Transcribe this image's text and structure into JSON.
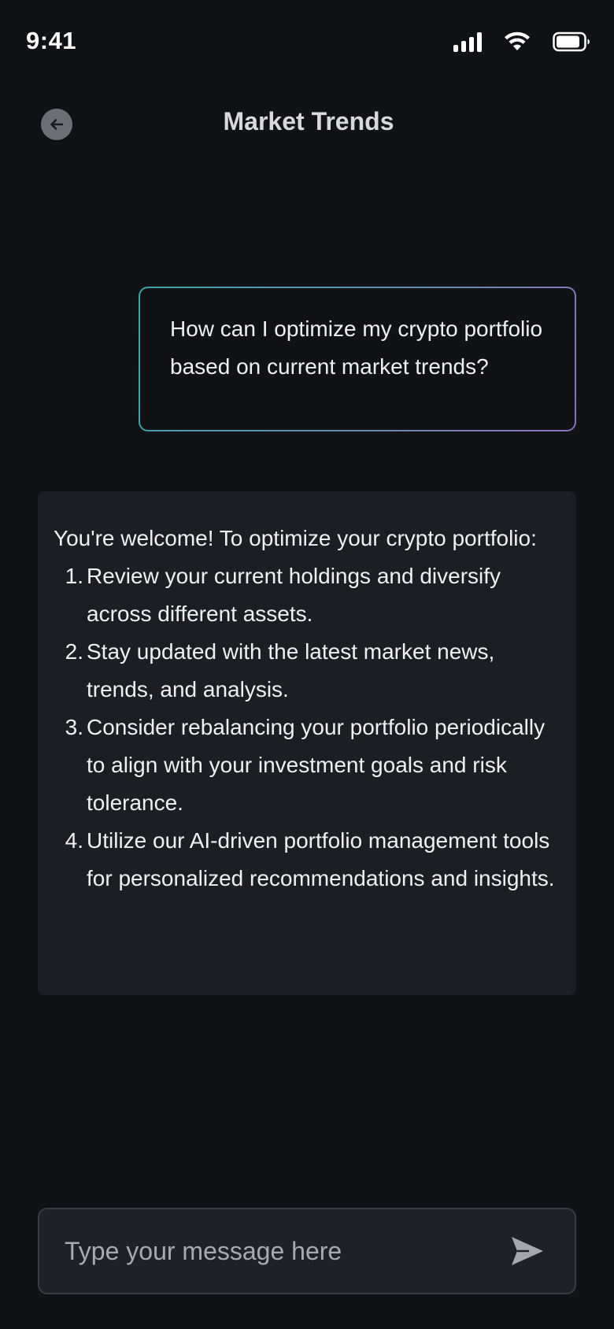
{
  "status_bar": {
    "time": "9:41",
    "icons": [
      "cellular-signal-icon",
      "wifi-icon",
      "battery-icon"
    ]
  },
  "header": {
    "back_icon": "arrow-left-icon",
    "title": "Market Trends"
  },
  "conversation": {
    "user_message": "How can I optimize my crypto portfolio based on current market trends?",
    "ai_response": {
      "intro": " You're welcome! To optimize your crypto portfolio:",
      "items": [
        {
          "num": "1.",
          "text": "Review your current holdings and diversify across different assets."
        },
        {
          "num": "2.",
          "text": "Stay updated with the latest market news, trends, and analysis."
        },
        {
          "num": "3.",
          "text": "Consider rebalancing your portfolio periodically to align with your investment goals and risk tolerance."
        },
        {
          "num": "4.",
          "text": "Utilize our AI-driven portfolio management tools for personalized recommendations and insights."
        }
      ]
    }
  },
  "composer": {
    "placeholder": "Type your message here",
    "value": "",
    "send_icon": "send-icon"
  },
  "colors": {
    "background": "#111216",
    "card": "#1d1e23",
    "bubble_border_start": "#3aa7a8",
    "bubble_border_end": "#8c6ec0",
    "icon_gray": "#6e6f75"
  }
}
